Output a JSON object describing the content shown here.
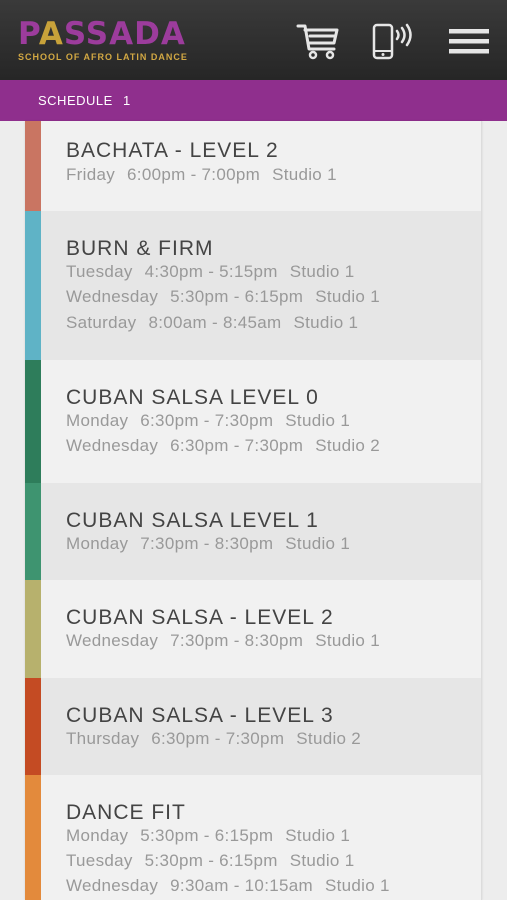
{
  "header": {
    "logo_prefix": "P",
    "logo_accent": "A",
    "logo_suffix": "SSADA",
    "tagline": "SCHOOL OF AFRO LATIN DANCE",
    "brand_color": "#8f2f8d",
    "accent_color": "#c8a23a",
    "icons": [
      "cart-icon",
      "phone-call-icon",
      "menu-icon"
    ]
  },
  "subbar": {
    "title": "SCHEDULE",
    "count": "1"
  },
  "classes": [
    {
      "title": "BACHATA - LEVEL 2",
      "color": "#c97562",
      "sessions": [
        {
          "day": "Friday",
          "time": "6:00pm - 7:00pm",
          "studio": "Studio 1"
        }
      ]
    },
    {
      "title": "BURN & FIRM",
      "color": "#5fb3c6",
      "sessions": [
        {
          "day": "Tuesday",
          "time": "4:30pm - 5:15pm",
          "studio": "Studio 1"
        },
        {
          "day": "Wednesday",
          "time": "5:30pm - 6:15pm",
          "studio": "Studio 1"
        },
        {
          "day": "Saturday",
          "time": "8:00am - 8:45am",
          "studio": "Studio 1"
        }
      ]
    },
    {
      "title": "CUBAN SALSA LEVEL 0",
      "color": "#2e7d5b",
      "sessions": [
        {
          "day": "Monday",
          "time": "6:30pm - 7:30pm",
          "studio": "Studio 1"
        },
        {
          "day": "Wednesday",
          "time": "6:30pm - 7:30pm",
          "studio": "Studio 2"
        }
      ]
    },
    {
      "title": "CUBAN SALSA LEVEL 1",
      "color": "#3e9470",
      "sessions": [
        {
          "day": "Monday",
          "time": "7:30pm - 8:30pm",
          "studio": "Studio 1"
        }
      ]
    },
    {
      "title": "CUBAN SALSA - LEVEL 2",
      "color": "#b7b16d",
      "sessions": [
        {
          "day": "Wednesday",
          "time": "7:30pm - 8:30pm",
          "studio": "Studio 1"
        }
      ]
    },
    {
      "title": "CUBAN SALSA - LEVEL 3",
      "color": "#c44b23",
      "sessions": [
        {
          "day": "Thursday",
          "time": "6:30pm - 7:30pm",
          "studio": "Studio 2"
        }
      ]
    },
    {
      "title": "DANCE FIT",
      "color": "#e38a3c",
      "sessions": [
        {
          "day": "Monday",
          "time": "5:30pm - 6:15pm",
          "studio": "Studio 1"
        },
        {
          "day": "Tuesday",
          "time": "5:30pm - 6:15pm",
          "studio": "Studio 1"
        },
        {
          "day": "Wednesday",
          "time": "9:30am - 10:15am",
          "studio": "Studio 1"
        }
      ]
    }
  ]
}
